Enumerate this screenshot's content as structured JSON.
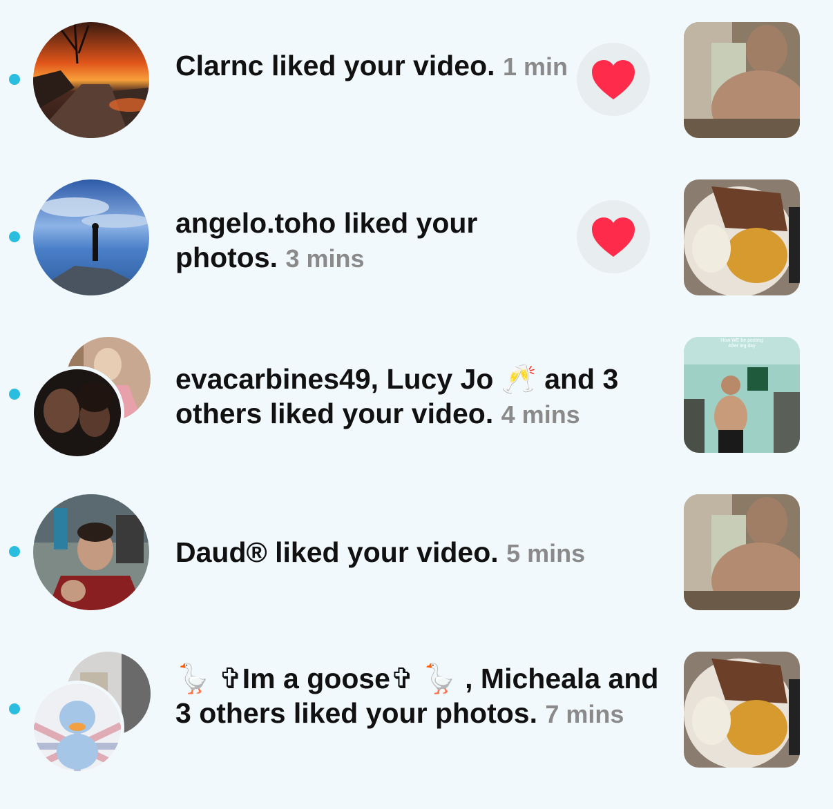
{
  "notifications": [
    {
      "users": "Clarnc",
      "action": " liked your video.",
      "time": "1 min",
      "has_like_button": true
    },
    {
      "users": "angelo.toho",
      "action": " liked your photos.",
      "time": "3 mins",
      "has_like_button": true
    },
    {
      "users": "evacarbines49, Lucy Jo 🥂  and 3 others",
      "action": " liked your video.",
      "time": "4 mins",
      "has_like_button": false,
      "thumbnail_caption_line1": "How WE be posting",
      "thumbnail_caption_line2": "After leg day"
    },
    {
      "users": "Daud®",
      "action": " liked your video.",
      "time": "5 mins",
      "has_like_button": false
    },
    {
      "users": "🪿 ✞Im a goose✞ 🪿 , Micheala and 3 others",
      "action": " liked your photos.",
      "time": "7 mins",
      "has_like_button": false
    }
  ],
  "colors": {
    "background": "#f2f9fc",
    "unread_dot": "#2bbde0",
    "heart": "#ff2b4a",
    "time_text": "#8a8a8a"
  },
  "icons": [
    "unread-dot-icon",
    "heart-icon"
  ]
}
